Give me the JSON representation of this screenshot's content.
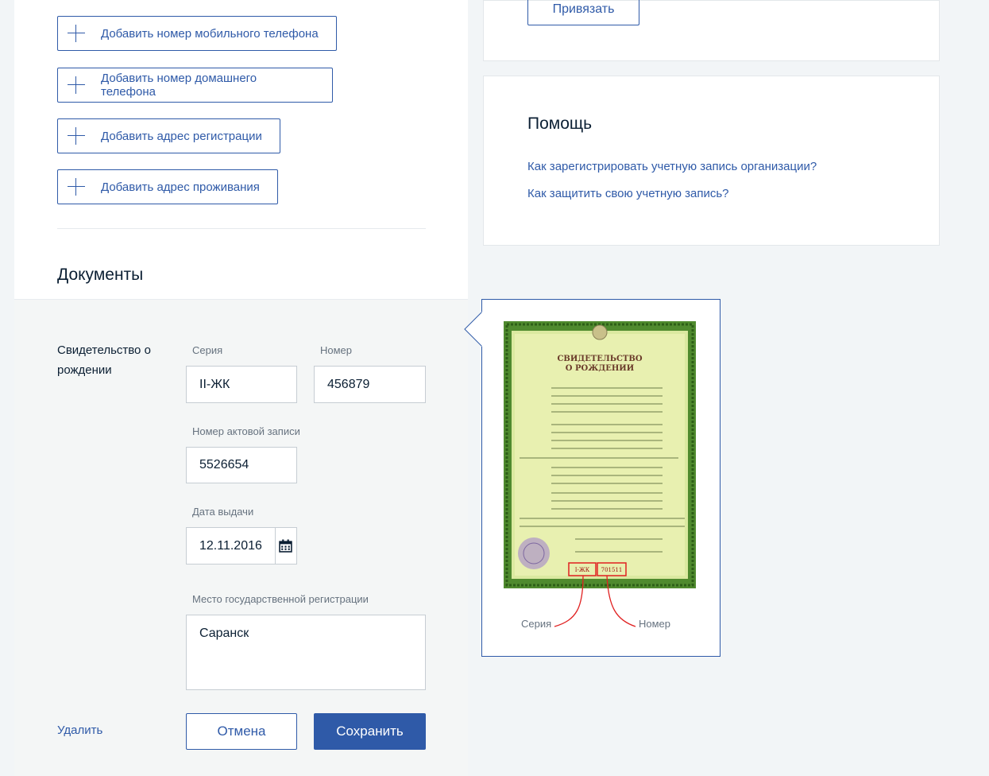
{
  "contacts": {
    "add_mobile": "Добавить номер мобильного телефона",
    "add_home_phone": "Добавить номер домашнего телефона",
    "add_reg_address": "Добавить адрес регистрации",
    "add_living_address": "Добавить адрес проживания"
  },
  "documents": {
    "title": "Документы",
    "doc_type": "Свидетельство о рождении",
    "series_label": "Серия",
    "series_value": "II-ЖК",
    "number_label": "Номер",
    "number_value": "456879",
    "act_label": "Номер актовой записи",
    "act_value": "5526654",
    "date_label": "Дата выдачи",
    "date_value": "12.11.2016",
    "place_label": "Место государственной регистрации",
    "place_value": "Саранск",
    "delete": "Удалить",
    "cancel": "Отмена",
    "save": "Сохранить"
  },
  "bind": {
    "button": "Привязать"
  },
  "help": {
    "title": "Помощь",
    "links": [
      "Как зарегистрировать учетную запись организации?",
      "Как защитить свою учетную запись?"
    ]
  },
  "hint": {
    "series_caption": "Серия",
    "number_caption": "Номер",
    "cert_title_1": "СВИДЕТЕЛЬСТВО",
    "cert_title_2": "О РОЖДЕНИИ",
    "cert_series": "I-ЖК",
    "cert_number": "701511"
  },
  "colors": {
    "accent": "#2f5aa8",
    "page_bg": "#f2f5f7",
    "form_bg": "#f4f6f6"
  }
}
